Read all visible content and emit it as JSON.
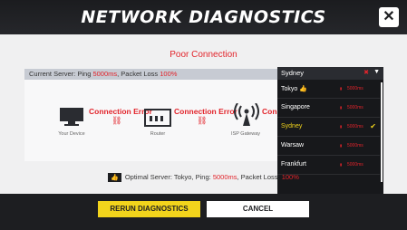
{
  "header": {
    "title": "NETWORK DIAGNOSTICS",
    "close_icon": "close-icon"
  },
  "status": {
    "poor_connection": "Poor Connection"
  },
  "current_server": {
    "prefix": "Current Server: Ping ",
    "ping": "5000ms",
    "mid": ", Packet Loss ",
    "loss": "100%"
  },
  "diagram": {
    "devices": [
      {
        "label": "Your Device",
        "icon": "monitor-icon"
      },
      {
        "label": "Router",
        "icon": "router-icon"
      },
      {
        "label": "ISP Gateway",
        "icon": "wifi-tower-icon"
      }
    ],
    "errors": [
      "Connection Error",
      "Connection Error",
      "Conne"
    ]
  },
  "server_dropdown": {
    "selected": "Sydney",
    "options": [
      {
        "name": "Tokyo",
        "ping": "5000ms",
        "thumb": true
      },
      {
        "name": "Singapore",
        "ping": "5000ms"
      },
      {
        "name": "Sydney",
        "ping": "5000ms",
        "selected": true
      },
      {
        "name": "Warsaw",
        "ping": "5000ms"
      },
      {
        "name": "Frankfurt",
        "ping": "5000ms"
      }
    ]
  },
  "optimal": {
    "prefix": "Optimal Server: Tokyo, Ping: ",
    "ping": "5000ms",
    "mid": ", Packet Loss: ",
    "loss": "100%"
  },
  "footer": {
    "rerun_label": "RERUN DIAGNOSTICS",
    "cancel_label": "CANCEL"
  },
  "colors": {
    "accent_yellow": "#f2d41c",
    "error_red": "#e2242b",
    "dark": "#1d1e21"
  }
}
